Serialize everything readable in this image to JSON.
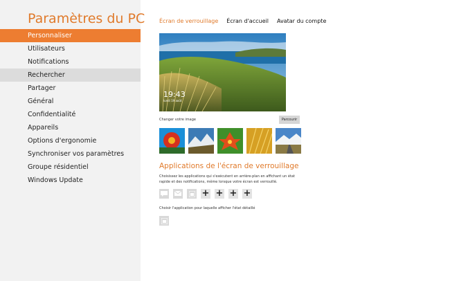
{
  "app": {
    "title": "Paramètres du PC"
  },
  "sidebar": {
    "items": [
      {
        "label": "Personnaliser"
      },
      {
        "label": "Utilisateurs"
      },
      {
        "label": "Notifications"
      },
      {
        "label": "Rechercher"
      },
      {
        "label": "Partager"
      },
      {
        "label": "Général"
      },
      {
        "label": "Confidentialité"
      },
      {
        "label": "Appareils"
      },
      {
        "label": "Options d'ergonomie"
      },
      {
        "label": "Synchroniser vos paramètres"
      },
      {
        "label": "Groupe résidentiel"
      },
      {
        "label": "Windows Update"
      }
    ]
  },
  "tabs": [
    {
      "label": "Écran de verrouillage"
    },
    {
      "label": "Écran d'accueil"
    },
    {
      "label": "Avatar du compte"
    }
  ],
  "lockscreen": {
    "time": "19:43",
    "date": "lundi 19 août"
  },
  "change_image": {
    "label": "Changer votre image",
    "browse": "Parcourir"
  },
  "apps_section": {
    "title": "Applications de l'écran de verrouillage",
    "description": "Choisissez les applications qui s'exécutent en arrière-plan en affichant un état rapide et des notifications, même lorsque votre écran est verrouillé.",
    "plus": "+",
    "detail_label": "Choisir l'application pour laquelle afficher l'état détaillé"
  },
  "colors": {
    "accent": "#ed7d31",
    "accent_text": "#e07a2b",
    "sidebar_bg": "#f2f2f2"
  }
}
